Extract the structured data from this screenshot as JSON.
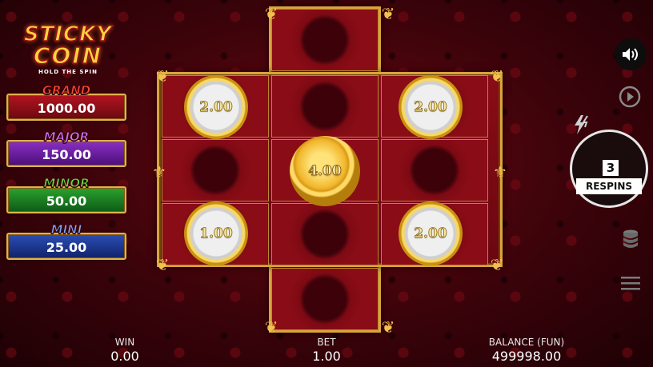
{
  "logo": {
    "line1": "STICKY",
    "line2": "COIN",
    "tagline": "HOLD THE SPIN"
  },
  "jackpots": [
    {
      "name": "GRAND",
      "value": "1000.00"
    },
    {
      "name": "MAJOR",
      "value": "150.00"
    },
    {
      "name": "MINOR",
      "value": "50.00"
    },
    {
      "name": "MINI",
      "value": "25.00"
    }
  ],
  "coins": {
    "top_left": "2.00",
    "top_right": "2.00",
    "center": "4.00",
    "bottom_left": "1.00",
    "bottom_right": "2.00"
  },
  "respins": {
    "count": "3",
    "label": "RESPINS"
  },
  "controls": {
    "sound_icon": "speaker-icon",
    "autoplay_icon": "autoplay-icon",
    "turbo_icon": "lightning-icon",
    "stake_icon": "coin-stack-icon",
    "menu_icon": "hamburger-menu-icon"
  },
  "footer": {
    "win_label": "WIN",
    "win_value": "0.00",
    "bet_label": "BET",
    "bet_value": "1.00",
    "balance_label": "BALANCE (FUN)",
    "balance_value": "499998.00"
  },
  "colors": {
    "gold": "#d9a43a",
    "background": "#6a0710",
    "grand": "#b11420",
    "major": "#8a2fc2",
    "minor": "#2aa22e",
    "mini": "#2b4fb6"
  }
}
